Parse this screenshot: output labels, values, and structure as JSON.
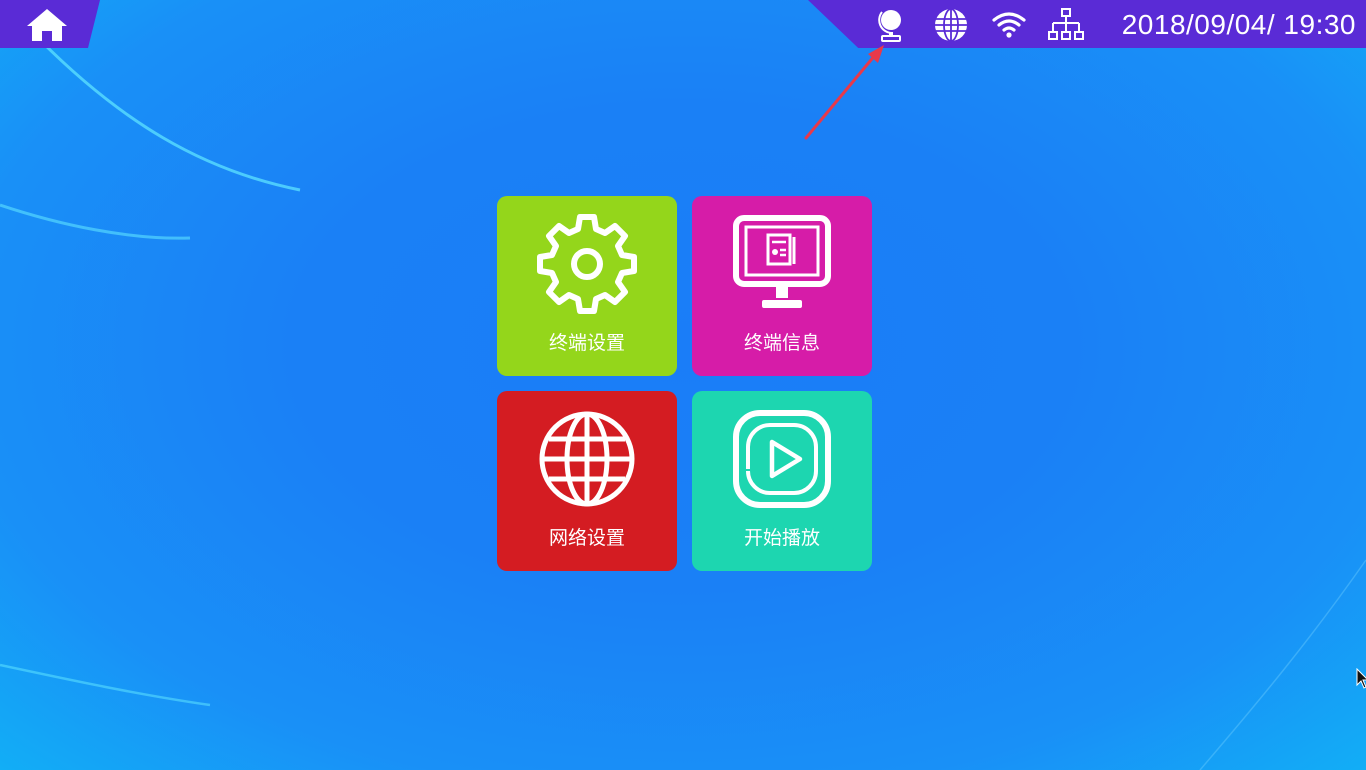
{
  "status_bar": {
    "datetime": "2018/09/04/ 19:30"
  },
  "tiles": [
    {
      "label": "终端设置",
      "color": "#94d61b",
      "icon": "gear-icon"
    },
    {
      "label": "终端信息",
      "color": "#d61ca8",
      "icon": "monitor-icon"
    },
    {
      "label": "网络设置",
      "color": "#d41c22",
      "icon": "globe-icon"
    },
    {
      "label": "开始播放",
      "color": "#1dd6b0",
      "icon": "play-icon"
    }
  ],
  "colors": {
    "topbar": "#5a2bd6",
    "background": "#1a80f6",
    "annotation_arrow": "#e8394a"
  }
}
